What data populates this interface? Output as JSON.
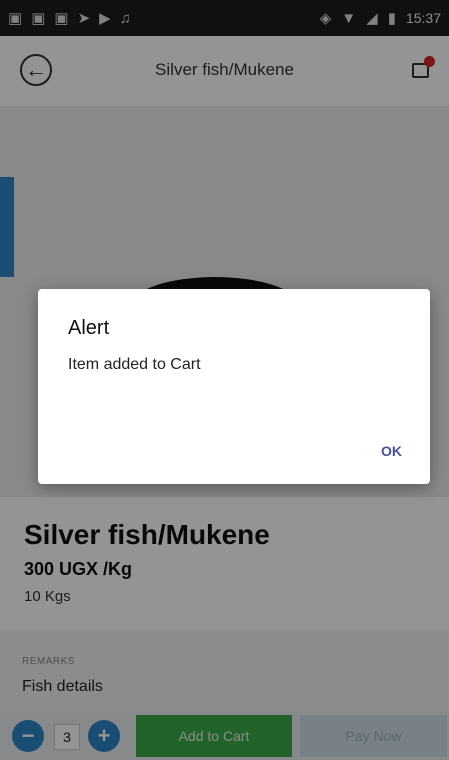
{
  "status_bar": {
    "time": "15:37",
    "left_icons": [
      "gallery-icon",
      "gallery-icon",
      "gallery-icon",
      "send-icon",
      "video-icon",
      "notification-icon"
    ],
    "right_icons": [
      "vibrate-icon",
      "wifi-icon",
      "signal-icon",
      "battery-icon"
    ]
  },
  "header": {
    "title": "Silver fish/Mukene",
    "back_icon": "back-arrow-icon",
    "cart_icon": "cart-icon"
  },
  "product": {
    "name": "Silver fish/Mukene",
    "price": "300 UGX /Kg",
    "quantity": "10 Kgs"
  },
  "remarks": {
    "label": "REMARKS",
    "text": "Fish details"
  },
  "bottom_bar": {
    "minus_label": "−",
    "quantity": "3",
    "plus_label": "+",
    "add_to_cart_label": "Add to Cart",
    "pay_now_label": "Pay Now"
  },
  "dialog": {
    "title": "Alert",
    "message": "Item added to Cart",
    "ok_label": "OK"
  },
  "colors": {
    "accent_blue": "#2d86c8",
    "add_to_cart_green": "#3cab4a",
    "ok_text": "#4a4f9a",
    "cart_badge": "#d0262e"
  }
}
